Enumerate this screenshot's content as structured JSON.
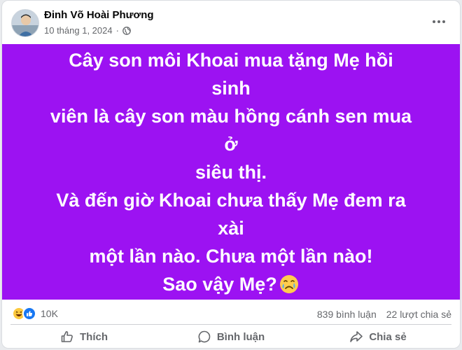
{
  "post": {
    "author": "Đinh Võ Hoài Phương",
    "date": "10 tháng 1, 2024",
    "separator": "·",
    "privacy_icon": "globe-icon",
    "more_icon": "more-options-icon",
    "background_color": "#9c12f2",
    "text_lines": [
      "Cây son môi Khoai mua tặng Mẹ hồi sinh",
      "viên là cây son màu hồng cánh sen mua ở",
      "siêu thị.",
      "Và đến giờ Khoai chưa thấy Mẹ đem ra xài",
      "một lần nào. Chưa một lần nào!",
      "Sao vậy Mẹ?"
    ],
    "trailing_emoji": "crying-face-emoji"
  },
  "stats": {
    "reaction_icons": [
      "haha-reaction-icon",
      "like-reaction-icon"
    ],
    "reaction_count": "10K",
    "comments": "839 bình luận",
    "shares": "22 lượt chia sẻ"
  },
  "actions": {
    "like_label": "Thích",
    "comment_label": "Bình luận",
    "share_label": "Chia sẻ"
  }
}
